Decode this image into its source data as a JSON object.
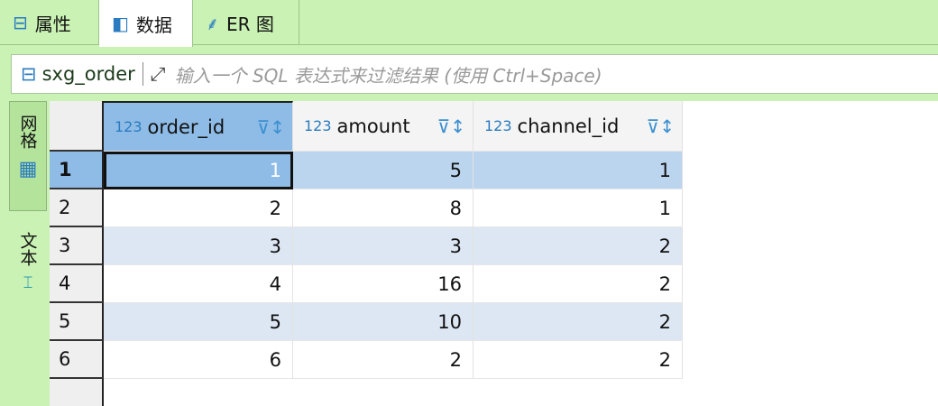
{
  "tabs": [
    {
      "label": "属性",
      "icon": "table-icon"
    },
    {
      "label": "数据",
      "icon": "data-icon",
      "active": true
    },
    {
      "label": "ER 图",
      "icon": "er-diagram-icon"
    }
  ],
  "filter": {
    "table": "sxg_order",
    "placeholder": "输入一个 SQL 表达式来过滤结果 (使用 Ctrl+Space)"
  },
  "side": {
    "grid": "网格",
    "text": "文本"
  },
  "columns": [
    {
      "name": "order_id",
      "type": "123",
      "key": true
    },
    {
      "name": "amount",
      "type": "123"
    },
    {
      "name": "channel_id",
      "type": "123"
    }
  ],
  "rows": [
    {
      "n": "1",
      "c": [
        "1",
        "5",
        "1"
      ]
    },
    {
      "n": "2",
      "c": [
        "2",
        "8",
        "1"
      ]
    },
    {
      "n": "3",
      "c": [
        "3",
        "3",
        "2"
      ]
    },
    {
      "n": "4",
      "c": [
        "4",
        "16",
        "2"
      ]
    },
    {
      "n": "5",
      "c": [
        "5",
        "10",
        "2"
      ]
    },
    {
      "n": "6",
      "c": [
        "6",
        "2",
        "2"
      ]
    }
  ],
  "colors": {
    "selected_header": "#8fbce6",
    "selected_row": "#bcd5ef",
    "stripe": "#dde7f4",
    "panel": "#c9f2b4"
  }
}
